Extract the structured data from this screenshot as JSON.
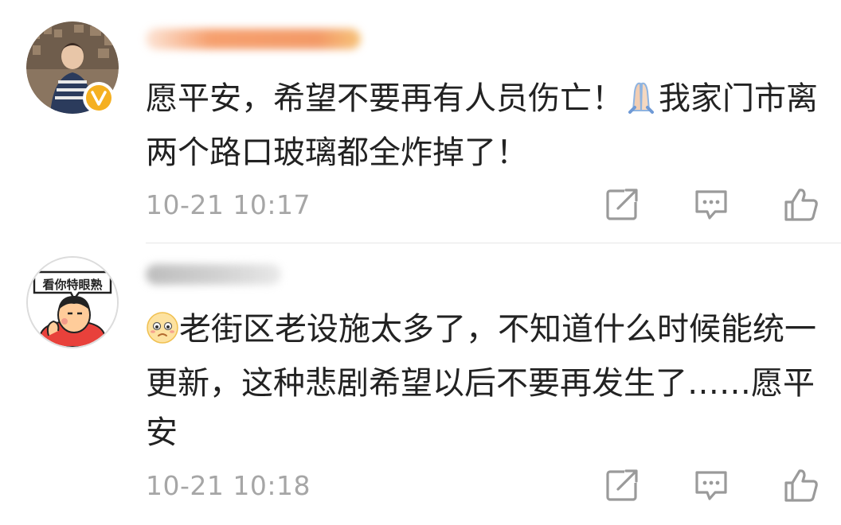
{
  "comments": [
    {
      "text": "愿平安，希望不要再有人员伤亡！",
      "text_after_emoji": "我家门市离两个路口玻璃都全炸掉了！",
      "emoji": "folded-hands",
      "verified": true,
      "timestamp": "10-21 10:17"
    },
    {
      "emoji": "worried-face",
      "text": "老街区老设施太多了，不知道什么时候能统一更新，这种悲剧希望以后不要再发生了……愿平安",
      "avatar_caption": "看你特眼熟",
      "timestamp": "10-21 10:18"
    }
  ],
  "icons": {
    "repost": "repost-icon",
    "comment": "comment-icon",
    "like": "thumbs-up-icon"
  },
  "colors": {
    "text": "#222222",
    "timestamp": "#a6a6a6",
    "icon": "#9a9a9a",
    "verified_badge": "#f5b021"
  }
}
